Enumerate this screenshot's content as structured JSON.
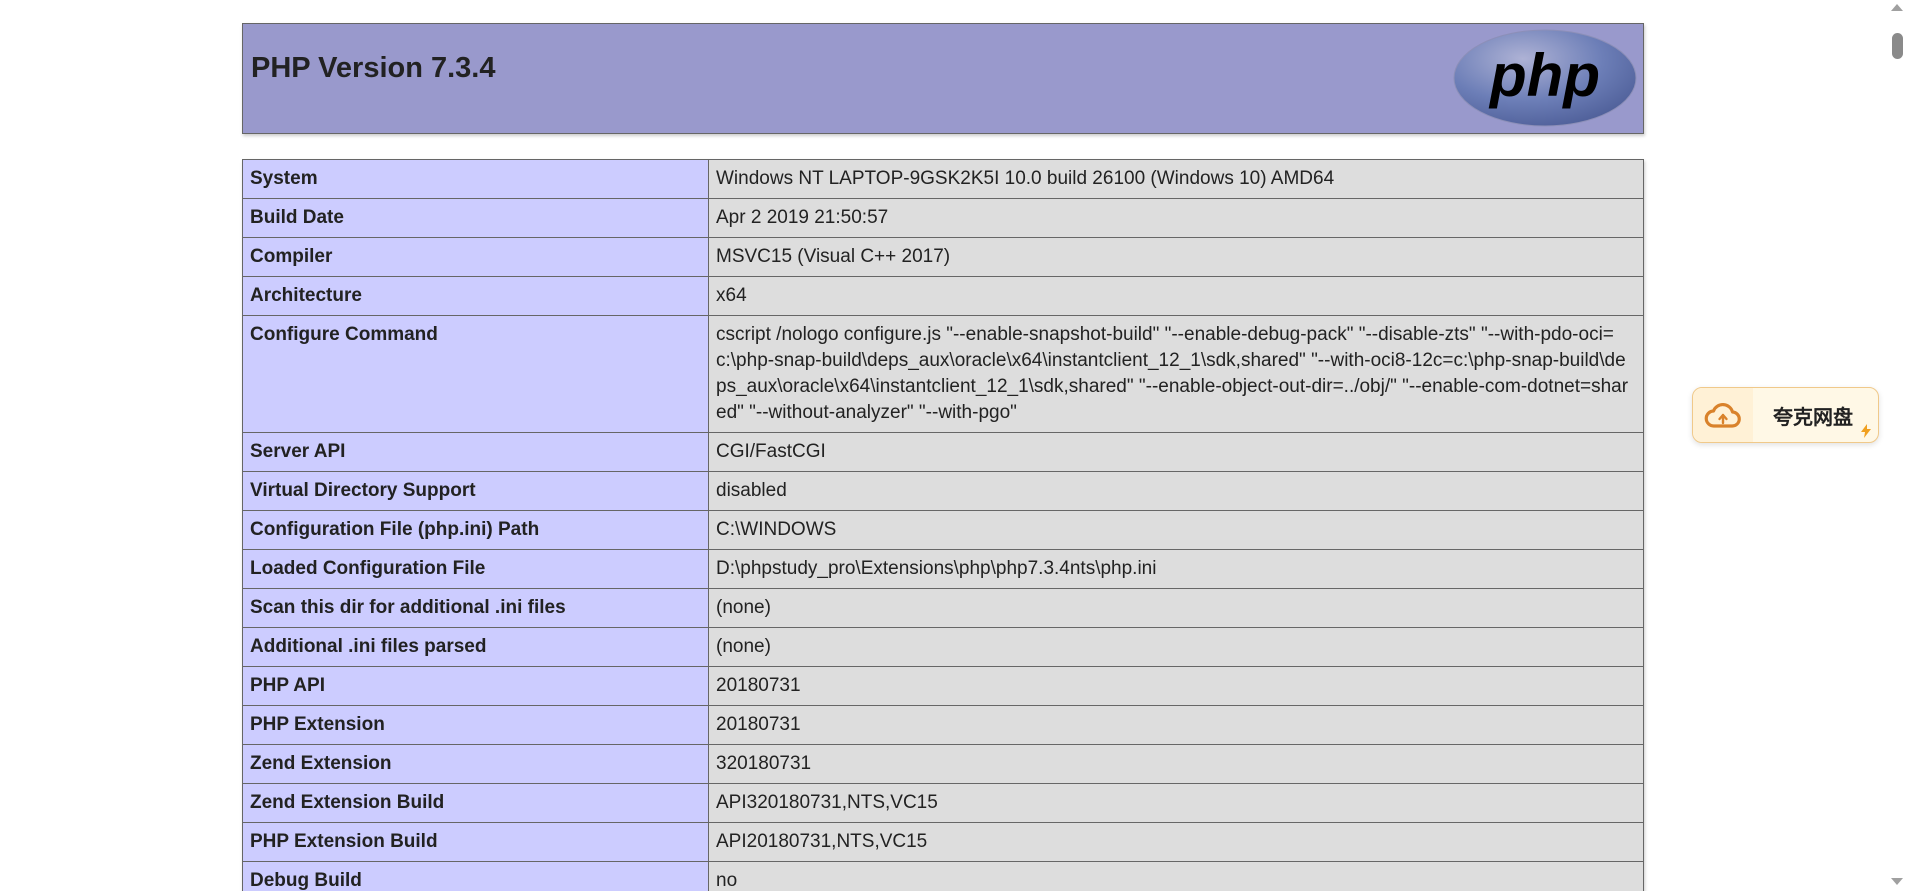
{
  "header": {
    "title": "PHP Version 7.3.4",
    "logo_text": "php"
  },
  "rows": [
    {
      "key": "System",
      "value": "Windows NT LAPTOP-9GSK2K5I 10.0 build 26100 (Windows 10) AMD64"
    },
    {
      "key": "Build Date",
      "value": "Apr 2 2019 21:50:57"
    },
    {
      "key": "Compiler",
      "value": "MSVC15 (Visual C++ 2017)"
    },
    {
      "key": "Architecture",
      "value": "x64"
    },
    {
      "key": "Configure Command",
      "value": "cscript /nologo configure.js \"--enable-snapshot-build\" \"--enable-debug-pack\" \"--disable-zts\" \"--with-pdo-oci=c:\\php-snap-build\\deps_aux\\oracle\\x64\\instantclient_12_1\\sdk,shared\" \"--with-oci8-12c=c:\\php-snap-build\\deps_aux\\oracle\\x64\\instantclient_12_1\\sdk,shared\" \"--enable-object-out-dir=../obj/\" \"--enable-com-dotnet=shared\" \"--without-analyzer\" \"--with-pgo\""
    },
    {
      "key": "Server API",
      "value": "CGI/FastCGI"
    },
    {
      "key": "Virtual Directory Support",
      "value": "disabled"
    },
    {
      "key": "Configuration File (php.ini) Path",
      "value": "C:\\WINDOWS"
    },
    {
      "key": "Loaded Configuration File",
      "value": "D:\\phpstudy_pro\\Extensions\\php\\php7.3.4nts\\php.ini"
    },
    {
      "key": "Scan this dir for additional .ini files",
      "value": "(none)"
    },
    {
      "key": "Additional .ini files parsed",
      "value": "(none)"
    },
    {
      "key": "PHP API",
      "value": "20180731"
    },
    {
      "key": "PHP Extension",
      "value": "20180731"
    },
    {
      "key": "Zend Extension",
      "value": "320180731"
    },
    {
      "key": "Zend Extension Build",
      "value": "API320180731,NTS,VC15"
    },
    {
      "key": "PHP Extension Build",
      "value": "API20180731,NTS,VC15"
    },
    {
      "key": "Debug Build",
      "value": "no"
    }
  ],
  "widget": {
    "label": "夸克网盘",
    "icon": "cloud-icon"
  },
  "colors": {
    "header_bg": "#9999cc",
    "key_bg": "#ccccff",
    "value_bg": "#dddddd",
    "logo_bg": "#6181b6"
  }
}
